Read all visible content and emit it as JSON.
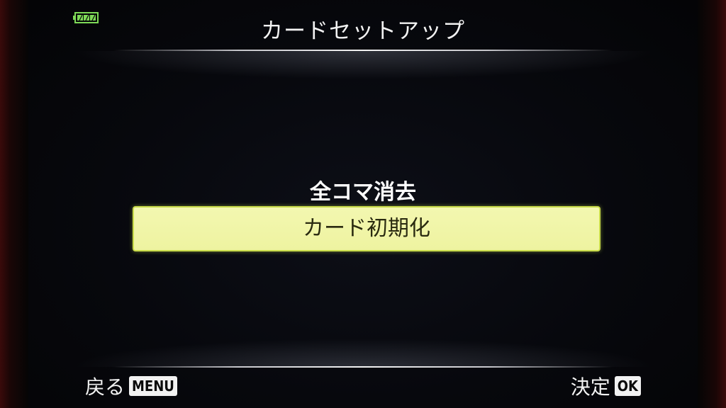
{
  "header": {
    "title": "カードセットアップ",
    "battery_icon": "battery-full-icon",
    "battery_color": "#7ed957"
  },
  "menu": {
    "items": [
      {
        "label": "全コマ消去",
        "selected": false
      },
      {
        "label": "カード初期化",
        "selected": true
      }
    ],
    "highlight_color": "#eef3a0"
  },
  "footer": {
    "back_label": "戻る",
    "back_key": "MENU",
    "confirm_label": "決定",
    "confirm_key": "OK"
  }
}
